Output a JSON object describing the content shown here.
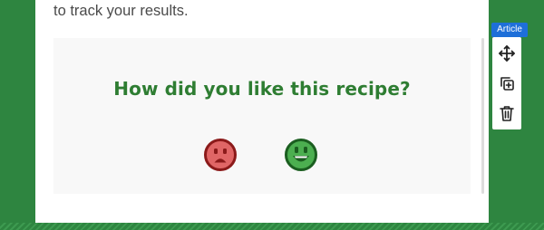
{
  "article": {
    "intro_text": "to track your results."
  },
  "rating_widget": {
    "question": "How did you like this recipe?",
    "options": [
      {
        "icon": "sad-face-icon",
        "color": "#e06666"
      },
      {
        "icon": "happy-face-icon",
        "color": "#4caf50"
      }
    ]
  },
  "block_toolbar": {
    "label": "Article",
    "accent_color": "#1e6fd9",
    "tools": [
      "move-icon",
      "duplicate-icon",
      "trash-icon"
    ]
  },
  "colors": {
    "background": "#2e8540",
    "question_text": "#2e7d32"
  }
}
